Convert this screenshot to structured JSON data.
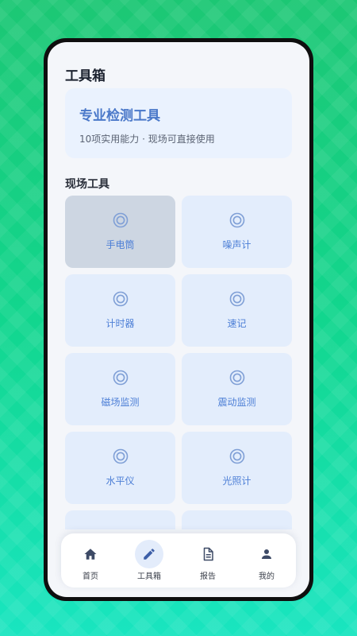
{
  "page": {
    "title": "工具箱"
  },
  "hero": {
    "title": "专业检测工具",
    "subtitle": "10项实用能力 · 现场可直接使用"
  },
  "section": {
    "title": "现场工具"
  },
  "tools": [
    {
      "label": "手电筒",
      "active": true
    },
    {
      "label": "噪声计",
      "active": false
    },
    {
      "label": "计时器",
      "active": false
    },
    {
      "label": "速记",
      "active": false
    },
    {
      "label": "磁场监测",
      "active": false
    },
    {
      "label": "震动监测",
      "active": false
    },
    {
      "label": "水平仪",
      "active": false
    },
    {
      "label": "光照计",
      "active": false
    },
    {
      "label": "",
      "active": false
    },
    {
      "label": "",
      "active": false
    }
  ],
  "tabbar": {
    "items": [
      {
        "label": "首页",
        "icon": "home-icon"
      },
      {
        "label": "工具箱",
        "icon": "pencil-icon",
        "active": true
      },
      {
        "label": "报告",
        "icon": "document-icon"
      },
      {
        "label": "我的",
        "icon": "person-icon"
      }
    ]
  },
  "colors": {
    "accent": "#4a78c9",
    "tile_bg": "#e3edfc",
    "tile_active_bg": "#cdd6e2",
    "icon": "#7f9fd6",
    "tab_icon": "#3d4a66"
  }
}
